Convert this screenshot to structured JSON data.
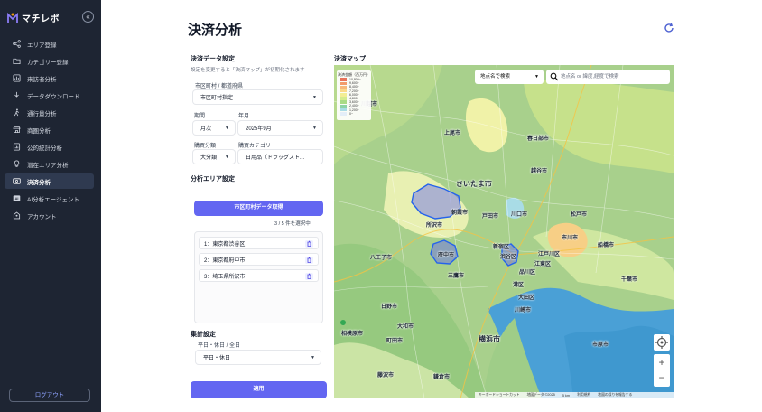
{
  "sidebar": {
    "brand": "マチレポ",
    "collapse_icon": "«",
    "items": [
      {
        "label": "エリア登録",
        "icon": "share-nodes-icon",
        "active": false
      },
      {
        "label": "カテゴリー登録",
        "icon": "folder-icon",
        "active": false
      },
      {
        "label": "来訪者分析",
        "icon": "chart-box-icon",
        "active": false
      },
      {
        "label": "データダウンロード",
        "icon": "download-icon",
        "active": false
      },
      {
        "label": "通行量分析",
        "icon": "walking-icon",
        "active": false
      },
      {
        "label": "商圏分析",
        "icon": "store-icon",
        "active": false
      },
      {
        "label": "公的統計分析",
        "icon": "document-chart-icon",
        "active": false
      },
      {
        "label": "潜在エリア分析",
        "icon": "lightbulb-icon",
        "active": false
      },
      {
        "label": "決済分析",
        "icon": "payment-card-icon",
        "active": true
      },
      {
        "label": "AI分析エージェント",
        "icon": "ai-icon",
        "active": false
      },
      {
        "label": "アカウント",
        "icon": "account-icon",
        "active": false
      }
    ],
    "logout_label": "ログアウト"
  },
  "header": {
    "title": "決済分析",
    "refresh_icon": "refresh-icon"
  },
  "settings": {
    "title": "決済データ設定",
    "subtitle": "設定を変更すると「決済マップ」が初期化されます",
    "area_label": "市区町村 / 都道府県",
    "area_value": "市区町村指定",
    "period_label": "期間",
    "period_value": "月次",
    "month_label": "年月",
    "month_value": "2025年9月",
    "category_class_label": "購買分類",
    "category_class_value": "大分類",
    "category_label": "購買カテゴリー",
    "category_value": "日用品（ドラッグスト..."
  },
  "analysis_area": {
    "title": "分析エリア設定",
    "fetch_button": "市区町村データ取得",
    "selection_count": "3 / 5 件を選択中",
    "items": [
      "1：東京都渋谷区",
      "2：東京都府中市",
      "3：埼玉県所沢市"
    ]
  },
  "aggregation": {
    "title": "集計設定",
    "day_label": "平日・休日 / 全日",
    "day_value": "平日・休日",
    "apply_button": "適用"
  },
  "map": {
    "title": "決済マップ",
    "search_type": "地点名で検索",
    "search_placeholder": "地点名 or 緯度,経度で検索",
    "legend_title": "決済金額（百万円）",
    "legend": [
      {
        "label": "10,800~",
        "color": "#e8735b"
      },
      {
        "label": "9,600~",
        "color": "#f29c6b"
      },
      {
        "label": "8,400~",
        "color": "#f7b97a"
      },
      {
        "label": "7,200~",
        "color": "#fbd98a"
      },
      {
        "label": "6,000~",
        "color": "#f3ee95"
      },
      {
        "label": "4,800~",
        "color": "#d4ec8e"
      },
      {
        "label": "3,600~",
        "color": "#a9db86"
      },
      {
        "label": "2,400~",
        "color": "#8dd3a6"
      },
      {
        "label": "1,200~",
        "color": "#a9dce6"
      },
      {
        "label": "0~",
        "color": "#e4eef8"
      }
    ],
    "places": [
      "川越市",
      "さいたま市",
      "八王子市",
      "新宿区",
      "横浜市",
      "川崎市",
      "大田区",
      "品川区",
      "船橋市",
      "千葉市",
      "三鷹市",
      "市川市",
      "江戸川区",
      "江東区",
      "日野市",
      "町田市",
      "所沢市",
      "府中市",
      "渋谷区",
      "春日部市",
      "越谷市",
      "川口市",
      "戸田市",
      "朝霞市",
      "上尾市",
      "松戸市",
      "市原市",
      "鎌倉市",
      "藤沢市",
      "大和市",
      "相模原市",
      "港区"
    ],
    "footer": [
      "キーボードショートカット",
      "地図データ ©2025",
      "5 km",
      "利用規約",
      "地図の誤りを報告する"
    ],
    "zoom_in": "+",
    "zoom_out": "−"
  }
}
